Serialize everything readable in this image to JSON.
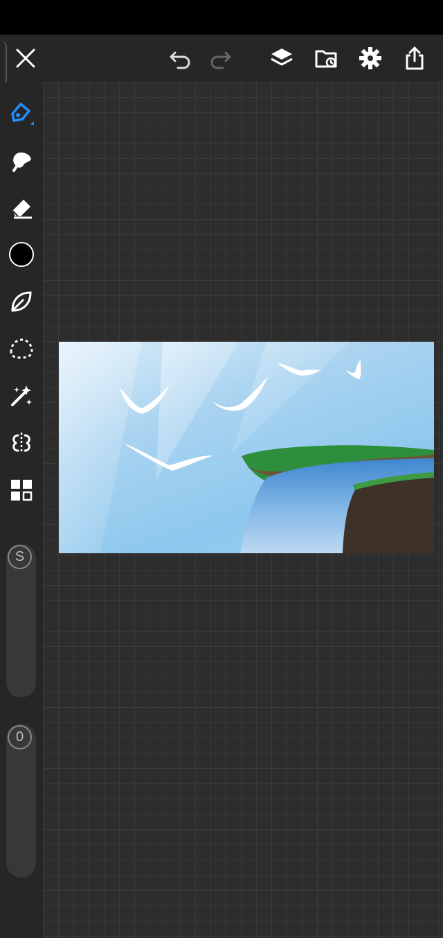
{
  "toolbar": {
    "close": "close-icon",
    "undo": "undo-icon",
    "redo": "redo-icon",
    "layers": "layers-icon",
    "gallery": "gallery-icon",
    "settings": "gear-icon",
    "share": "share-icon"
  },
  "tools": [
    {
      "name": "brush",
      "active": true
    },
    {
      "name": "smudge"
    },
    {
      "name": "eraser"
    },
    {
      "name": "color"
    },
    {
      "name": "lasso-fill"
    },
    {
      "name": "selection"
    },
    {
      "name": "magic-wand"
    },
    {
      "name": "symmetry"
    },
    {
      "name": "grid"
    }
  ],
  "brush_size": {
    "label": "S"
  },
  "opacity": {
    "label": "0"
  },
  "colors": {
    "accent": "#1e90ff",
    "current_color": "#000000",
    "toolbar_bg": "#262626",
    "canvas_bg": "#2d2d2d"
  }
}
